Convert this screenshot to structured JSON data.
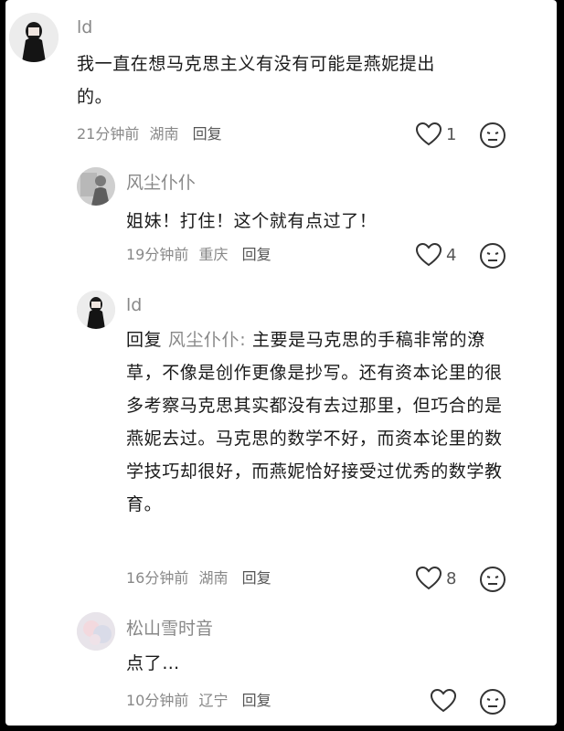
{
  "comments": [
    {
      "user": "ld",
      "text": "我一直在想马克思主义有没有可能是燕妮提出的。",
      "time": "21分钟前",
      "location": "湖南",
      "reply_label": "回复",
      "likes": "1",
      "avatar": "girl-dark-avatar"
    },
    {
      "user": "风尘仆仆",
      "text": "姐妹！打住！这个就有点过了！",
      "time": "19分钟前",
      "location": "重庆",
      "reply_label": "回复",
      "likes": "4",
      "avatar": "grey-figure-avatar"
    },
    {
      "user": "ld",
      "reply_prefix": "回复",
      "reply_to": "风尘仆仆:",
      "text": "主要是马克思的手稿非常的潦草，不像是创作更像是抄写。还有资本论里的很多考察马克思其实都没有去过那里，但巧合的是燕妮去过。马克思的数学不好，而资本论里的数学技巧却很好，而燕妮恰好接受过优秀的数学教育。",
      "time": "16分钟前",
      "location": "湖南",
      "reply_label": "回复",
      "likes": "8",
      "avatar": "girl-dark-avatar"
    },
    {
      "user": "松山雪时音",
      "text": "点了…",
      "time": "10分钟前",
      "location": "辽宁",
      "reply_label": "回复",
      "likes": "",
      "avatar": "pastel-blur-avatar"
    }
  ]
}
